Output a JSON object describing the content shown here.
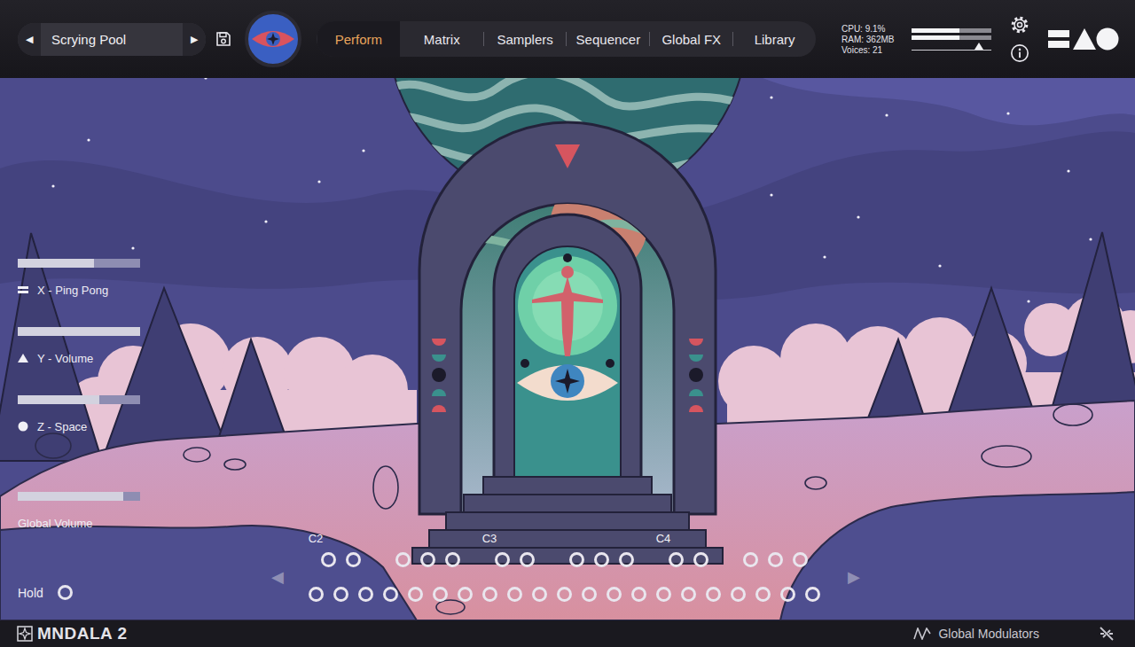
{
  "preset": {
    "prev": "◀",
    "name": "Scrying Pool",
    "next": "▶"
  },
  "tabs": [
    {
      "label": "Perform",
      "selected": true
    },
    {
      "label": "Matrix",
      "selected": false
    },
    {
      "label": "Samplers",
      "selected": false
    },
    {
      "label": "Sequencer",
      "selected": false
    },
    {
      "label": "Global FX",
      "selected": false
    },
    {
      "label": "Library",
      "selected": false
    }
  ],
  "stats": [
    "CPU: 9.1%",
    "RAM: 362MB",
    "Voices: 21"
  ],
  "output": {
    "meters": [
      {
        "level": 0.6
      },
      {
        "level": 0.6
      }
    ],
    "volume": {
      "level": 0.84
    }
  },
  "macros": [
    {
      "label": "X - Ping Pong",
      "kind": "lines",
      "level": 0.62
    },
    {
      "label": "Y - Volume",
      "kind": "triangle",
      "level": 1.0
    },
    {
      "label": "Z - Space",
      "kind": "circle",
      "level": 0.67
    },
    {
      "label": "Global Volume",
      "kind": "plain",
      "level": 0.86
    }
  ],
  "hold": {
    "label": "Hold",
    "on": false
  },
  "keyboard": {
    "prev": "◀",
    "next": "▶",
    "octave_labels": [
      "C2",
      "C3",
      "C4"
    ],
    "white_keys": [
      {
        "pressed": false
      },
      {
        "pressed": false
      },
      {
        "pressed": false
      },
      {
        "pressed": false
      },
      {
        "pressed": false
      },
      {
        "pressed": false
      },
      {
        "pressed": false
      },
      {
        "pressed": false
      },
      {
        "pressed": false
      },
      {
        "pressed": false
      },
      {
        "pressed": false
      },
      {
        "pressed": false
      },
      {
        "pressed": false
      },
      {
        "pressed": false
      },
      {
        "pressed": false
      },
      {
        "pressed": false
      },
      {
        "pressed": false
      },
      {
        "pressed": false
      },
      {
        "pressed": false
      },
      {
        "pressed": false
      },
      {
        "pressed": false
      }
    ],
    "black_keys": [
      {
        "pressed": false
      },
      {
        "pressed": false
      },
      {
        "pressed": false
      },
      {
        "pressed": false
      },
      {
        "pressed": false
      },
      {
        "pressed": false
      },
      {
        "pressed": false
      },
      {
        "pressed": false
      },
      {
        "pressed": false
      },
      {
        "pressed": false
      },
      {
        "pressed": false
      },
      {
        "pressed": false
      },
      {
        "pressed": false
      },
      {
        "pressed": false
      },
      {
        "pressed": false
      }
    ]
  },
  "bottom_bar": {
    "logo": "MNDALA 2",
    "modulators": "Global Modulators"
  }
}
